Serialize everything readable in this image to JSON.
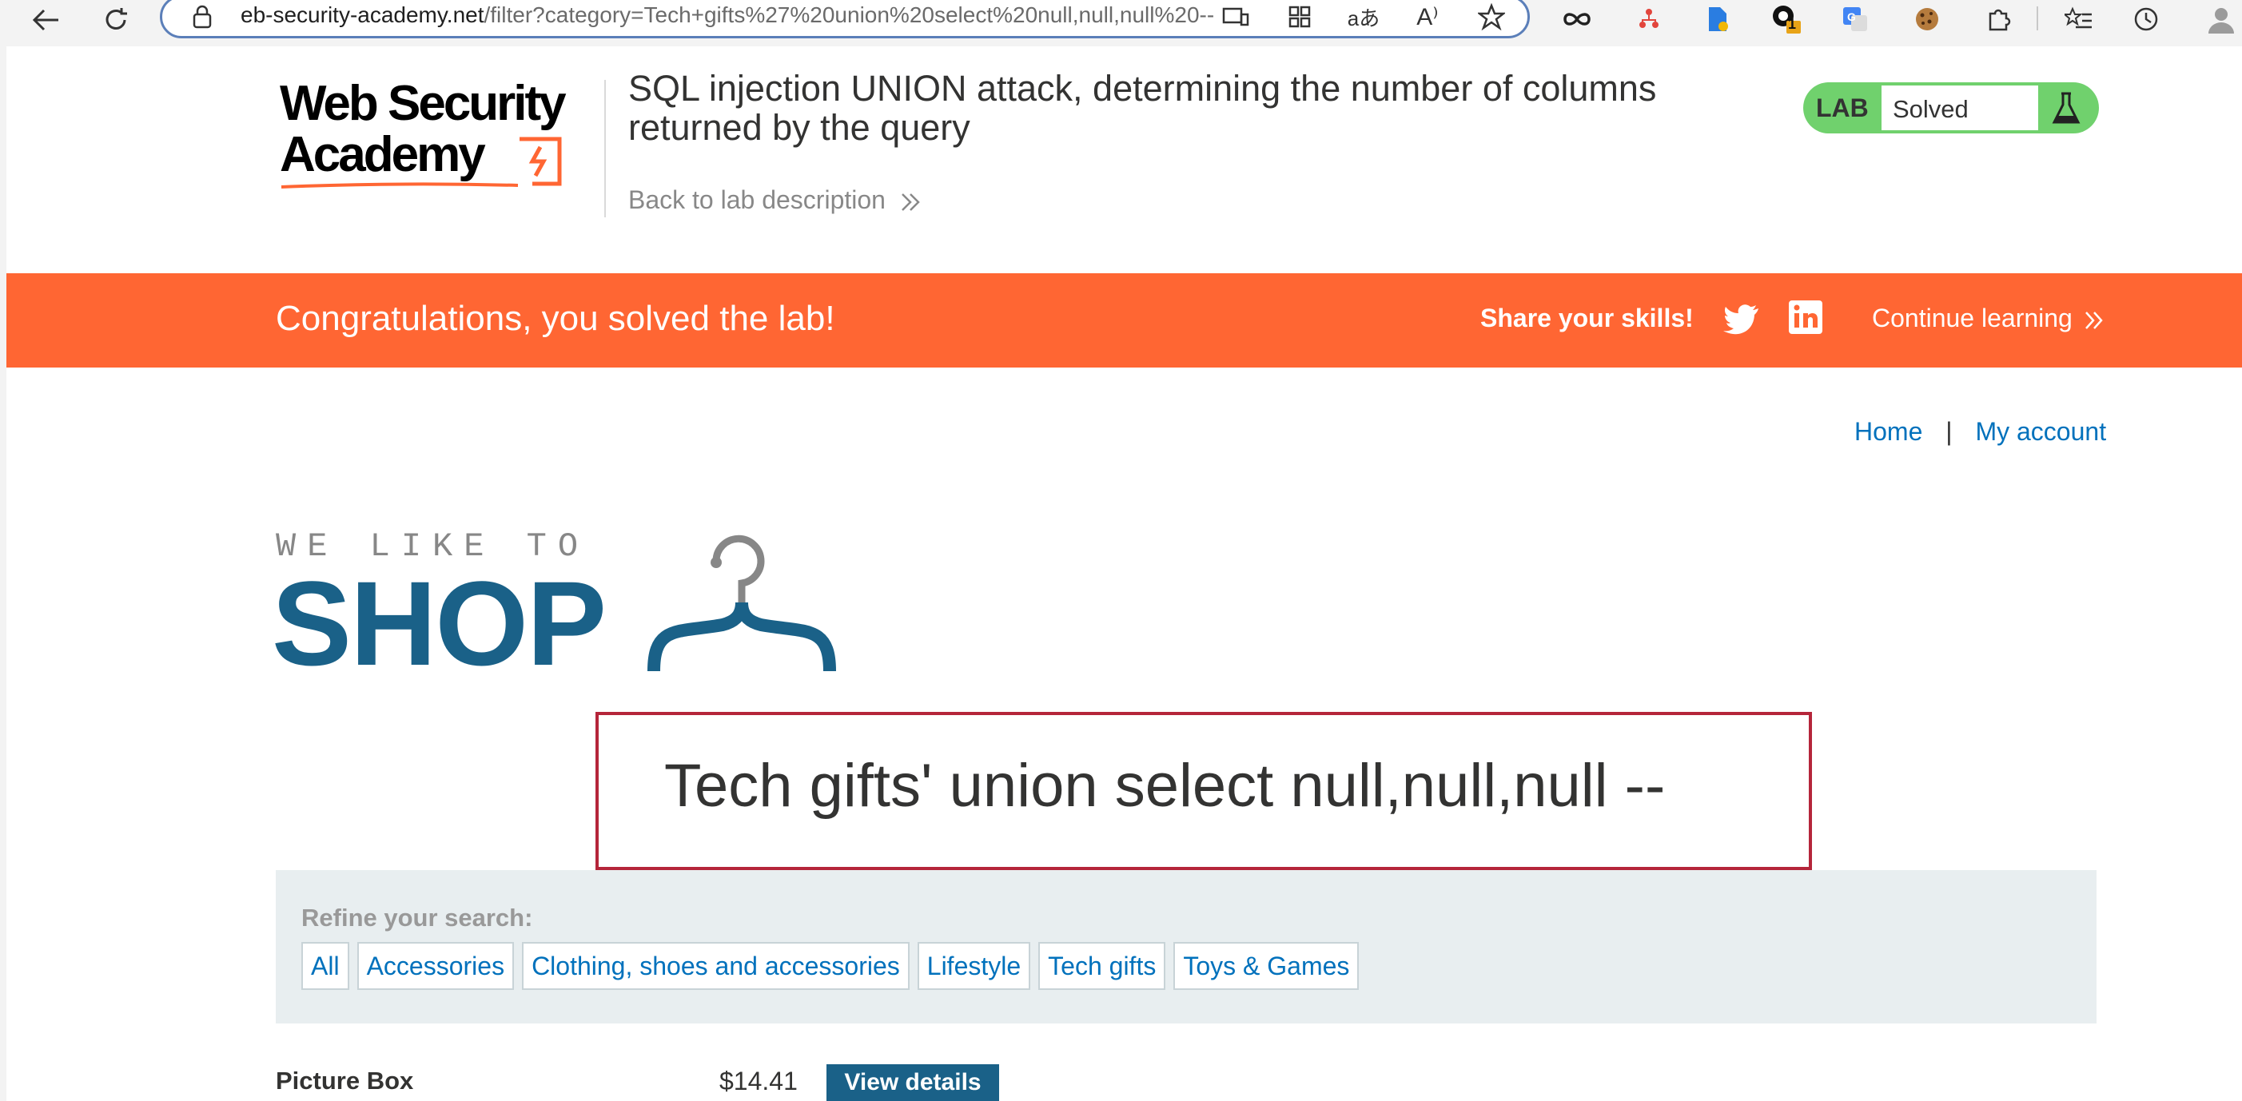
{
  "browser": {
    "url_prefix": "eb-security-academy.net",
    "url_rest": "/filter?category=Tech+gifts%27%20union%20select%20null,null,null%20--",
    "icons": [
      "back-arrow-icon",
      "reload-icon",
      "lock-icon",
      "tab-icon",
      "apps-icon",
      "translate-icon",
      "read-aloud-icon",
      "favorite-star-icon",
      "infinity-icon",
      "extension-tree-icon",
      "extension-doc-icon",
      "extension-badge-icon",
      "google-translate-icon",
      "cookie-icon",
      "puzzle-icon",
      "favorites-list-icon",
      "history-icon",
      "profile-icon"
    ],
    "badge_count": "1"
  },
  "header": {
    "logo_line1": "Web Security",
    "logo_line2": "Academy",
    "lab_title": "SQL injection UNION attack, determining the number of columns returned by the query",
    "back_link": "Back to lab description",
    "status_label": "LAB",
    "status_value": "Solved"
  },
  "banner": {
    "message": "Congratulations, you solved the lab!",
    "share": "Share your skills!",
    "continue": "Continue learning"
  },
  "nav": {
    "home": "Home",
    "separator": "|",
    "account": "My account"
  },
  "shop_logo": {
    "tagline": "WE LIKE TO",
    "word": "SHOP"
  },
  "category_heading": "Tech gifts' union select null,null,null --",
  "filters": {
    "label": "Refine your search:",
    "items": [
      "All",
      "Accessories",
      "Clothing, shoes and accessories",
      "Lifestyle",
      "Tech gifts",
      "Toys & Games"
    ]
  },
  "products": [
    {
      "name": "Picture Box",
      "price": "$14.41",
      "action": "View details"
    }
  ],
  "colors": {
    "banner": "#ff6633",
    "link": "#0071bc",
    "shop_blue": "#1a6188",
    "solved_green": "#70d16d",
    "heading_border": "#b5253a"
  }
}
